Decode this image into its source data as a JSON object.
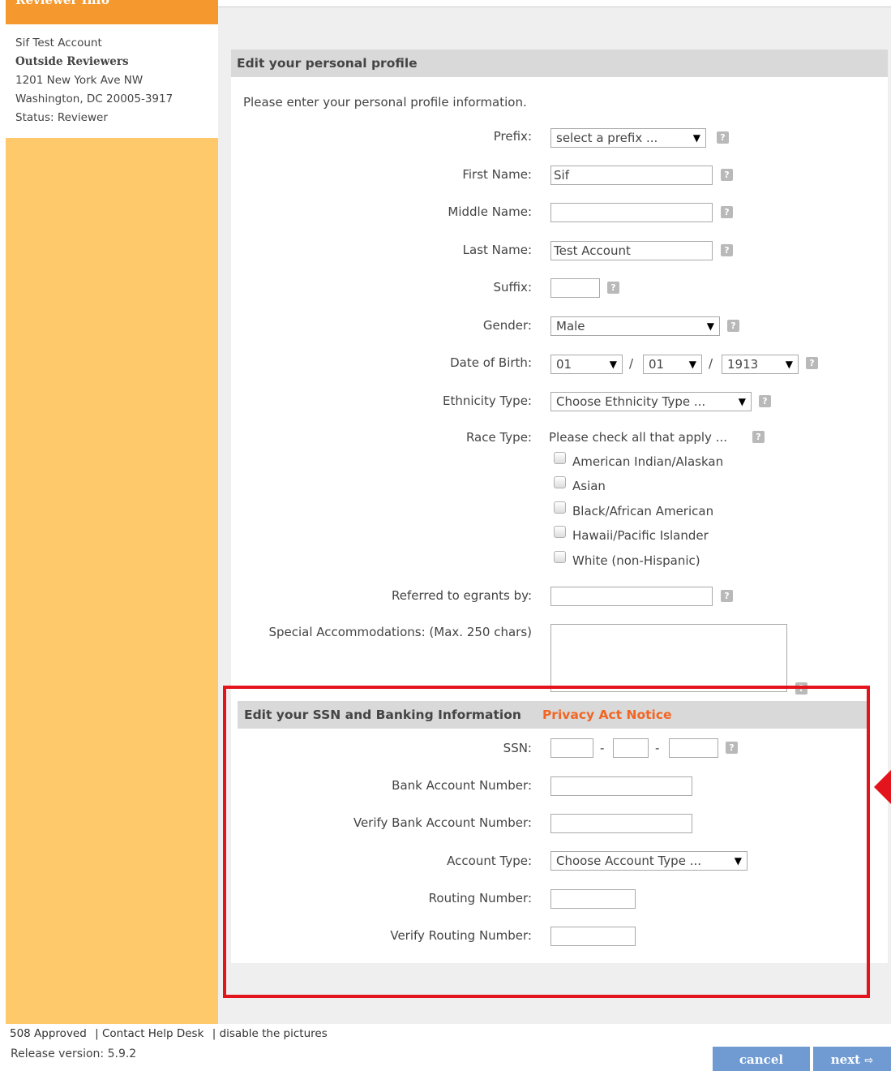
{
  "sidebar": {
    "header": "Reviewer Info",
    "name": "Sif Test Account",
    "organization": "Outside Reviewers",
    "address1": "1201 New York Ave NW",
    "address2": "Washington, DC 20005-3917",
    "status": "Status: Reviewer"
  },
  "profile": {
    "heading": "Edit your personal profile",
    "intro": "Please enter your personal profile information.",
    "prefix": {
      "label": "Prefix:",
      "value": "select a prefix ..."
    },
    "first_name": {
      "label": "First Name:",
      "value": "Sif"
    },
    "middle_name": {
      "label": "Middle Name:",
      "value": ""
    },
    "last_name": {
      "label": "Last Name:",
      "value": "Test Account"
    },
    "suffix": {
      "label": "Suffix:",
      "value": ""
    },
    "gender": {
      "label": "Gender:",
      "value": "Male"
    },
    "dob": {
      "label": "Date of Birth:",
      "month": "01",
      "day": "01",
      "year": "1913",
      "sep": "/"
    },
    "ethnicity": {
      "label": "Ethnicity Type:",
      "value": "Choose Ethnicity Type ..."
    },
    "race": {
      "label": "Race Type:",
      "hint": "Please check all that apply ...",
      "options": [
        "American Indian/Alaskan",
        "Asian",
        "Black/African American",
        "Hawaii/Pacific Islander",
        "White (non-Hispanic)"
      ]
    },
    "referred": {
      "label": "Referred to egrants by:",
      "value": ""
    },
    "accommodations": {
      "label": "Special Accommodations: (Max. 250 chars)",
      "value": ""
    }
  },
  "banking": {
    "heading": "Edit your SSN and Banking Information",
    "privacy_link": "Privacy Act Notice",
    "ssn": {
      "label": "SSN:",
      "sep": "-"
    },
    "bank_account": {
      "label": "Bank Account Number:"
    },
    "verify_bank_account": {
      "label": "Verify Bank Account Number:"
    },
    "account_type": {
      "label": "Account Type:",
      "value": "Choose Account Type ..."
    },
    "routing": {
      "label": "Routing Number:"
    },
    "verify_routing": {
      "label": "Verify Routing Number:"
    }
  },
  "footer": {
    "link1": "508 Approved",
    "link2": "Contact Help Desk",
    "link3": "disable the pictures",
    "separator": "|",
    "release": "Release version: 5.9.2"
  },
  "buttons": {
    "cancel": "cancel",
    "next": "next"
  },
  "icons": {
    "help": "?",
    "dropdown": "▼",
    "next_arrow": "⇨"
  },
  "colors": {
    "highlight": "#e3141b",
    "sidebar": "#fdc96a",
    "sidebar_header": "#f5982e",
    "privacy_link": "#f26522",
    "button": "#6f9bd2"
  }
}
